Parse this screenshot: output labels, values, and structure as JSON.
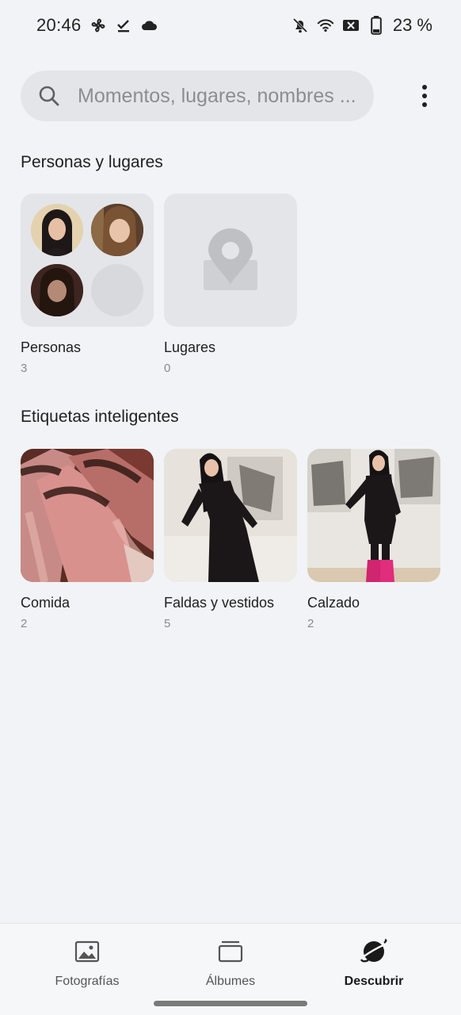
{
  "status_bar": {
    "time": "20:46",
    "battery": "23 %",
    "icons_left": [
      "fan-icon",
      "check-download-icon",
      "cloud-icon"
    ],
    "icons_right": [
      "bell-off-icon",
      "wifi-icon",
      "no-sim-icon",
      "battery-icon"
    ]
  },
  "search": {
    "placeholder": "Momentos, lugares, nombres ..."
  },
  "people_places": {
    "title": "Personas y lugares",
    "people": {
      "label": "Personas",
      "count": "3"
    },
    "places": {
      "label": "Lugares",
      "count": "0"
    }
  },
  "smart_tags": {
    "title": "Etiquetas inteligentes",
    "items": [
      {
        "label": "Comida",
        "count": "2"
      },
      {
        "label": "Faldas y vestidos",
        "count": "5"
      },
      {
        "label": "Calzado",
        "count": "2"
      }
    ]
  },
  "nav": {
    "items": [
      {
        "label": "Fotografías",
        "icon": "photo-icon"
      },
      {
        "label": "Álbumes",
        "icon": "albums-icon"
      },
      {
        "label": "Descubrir",
        "icon": "planet-icon"
      }
    ],
    "active": "Descubrir"
  },
  "colors": {
    "background": "#f2f3f6",
    "card": "#e4e5e8",
    "text": "#1f1f1f",
    "secondary_text": "#8a8a8a"
  }
}
